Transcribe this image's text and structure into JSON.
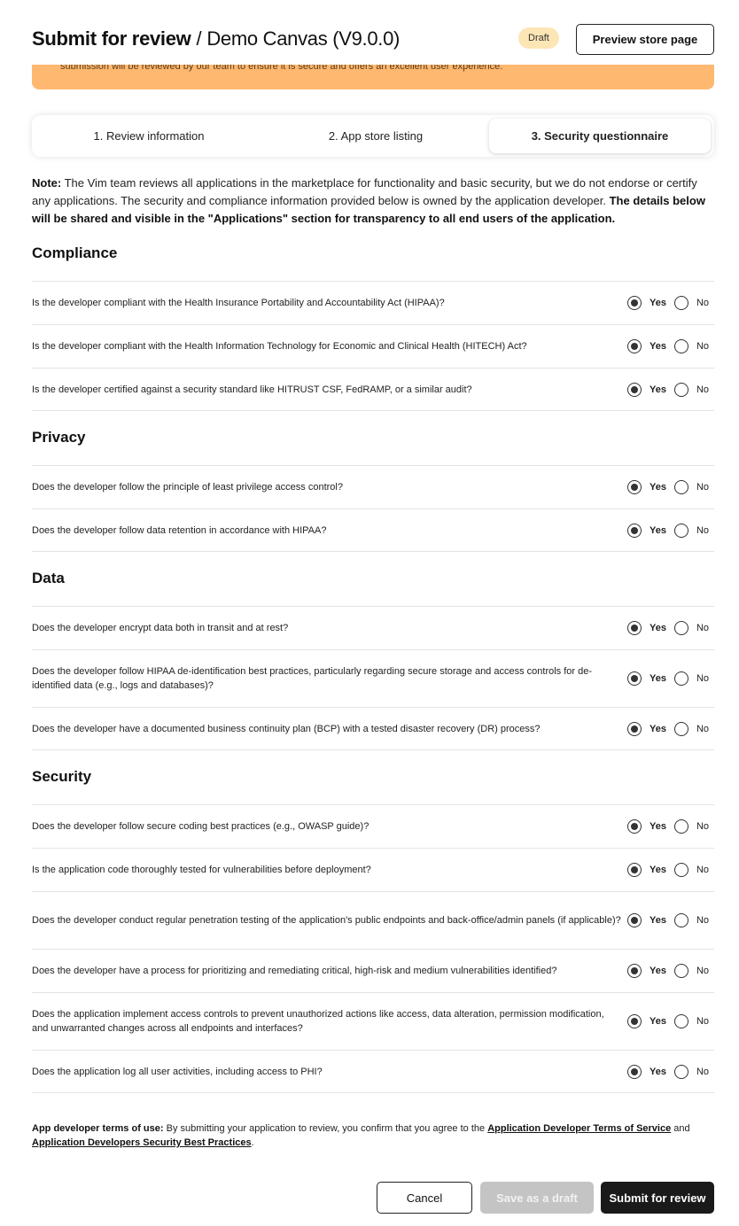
{
  "header": {
    "title_strong": "Submit for review",
    "separator": "/",
    "app_name": "Demo Canvas (V9.0.0)",
    "status_badge": "Draft",
    "preview_button": "Preview store page"
  },
  "banner": {
    "text": "submission will be reviewed by our team to ensure it is secure and offers an excellent user experience.",
    "color": "#ffb870"
  },
  "steps": [
    {
      "label": "1. Review information",
      "active": false
    },
    {
      "label": "2. App store listing",
      "active": false
    },
    {
      "label": "3. Security questionnaire",
      "active": true
    }
  ],
  "note": {
    "label": "Note:",
    "text": " The Vim team reviews all applications in the marketplace for functionality and basic security, but we do not endorse or certify any applications. The security and compliance information provided below is owned by the application developer. ",
    "bold_text": "The details below will be shared and visible in the \"Applications\" section for transparency to all end users of the application."
  },
  "radio_labels": {
    "yes": "Yes",
    "no": "No"
  },
  "sections": [
    {
      "title": "Compliance",
      "questions": [
        {
          "text": "Is the developer compliant with the Health Insurance Portability and Accountability Act (HIPAA)?",
          "answer": "yes"
        },
        {
          "text": "Is the developer compliant with the Health Information Technology for Economic and Clinical Health (HITECH) Act?",
          "answer": "yes"
        },
        {
          "text": "Is the developer certified against a security standard like HITRUST CSF, FedRAMP, or a similar audit?",
          "answer": "yes"
        }
      ]
    },
    {
      "title": "Privacy",
      "questions": [
        {
          "text": "Does the developer follow the principle of least privilege access control?",
          "answer": "yes"
        },
        {
          "text": "Does the developer follow data retention in accordance with HIPAA?",
          "answer": "yes"
        }
      ]
    },
    {
      "title": "Data",
      "questions": [
        {
          "text": "Does the developer encrypt data both in transit and at rest?",
          "answer": "yes"
        },
        {
          "text": "Does the developer follow HIPAA de-identification best practices, particularly regarding secure storage and access controls for de-identified data (e.g., logs and databases)?",
          "answer": "yes"
        },
        {
          "text": "Does the developer have a documented business continuity plan (BCP) with a tested disaster recovery (DR) process?",
          "answer": "yes"
        }
      ]
    },
    {
      "title": "Security",
      "questions": [
        {
          "text": "Does the developer follow secure coding best practices (e.g., OWASP guide)?",
          "answer": "yes"
        },
        {
          "text": "Is the application code thoroughly tested for vulnerabilities before deployment?",
          "answer": "yes"
        },
        {
          "text": "Does the developer conduct regular penetration testing of the application's public endpoints and back-office/admin panels (if applicable)?",
          "answer": "yes"
        },
        {
          "text": "Does the developer have a process for prioritizing and remediating critical, high-risk and medium vulnerabilities identified?",
          "answer": "yes"
        },
        {
          "text": "Does the application implement access controls to prevent unauthorized actions like access, data alteration, permission modification, and unwarranted changes across all endpoints and interfaces?",
          "answer": "yes"
        },
        {
          "text": "Does the application log all user activities, including access to PHI?",
          "answer": "yes"
        }
      ]
    }
  ],
  "terms": {
    "label": "App developer terms of use:",
    "text": " By submitting your application to review, you confirm that you agree to the ",
    "link1": "Application Developer Terms of Service",
    "and": " and ",
    "link2": "Application Developers Security Best Practices",
    "end": "."
  },
  "footer": {
    "cancel": "Cancel",
    "save_draft": "Save as a draft",
    "submit": "Submit for review"
  }
}
